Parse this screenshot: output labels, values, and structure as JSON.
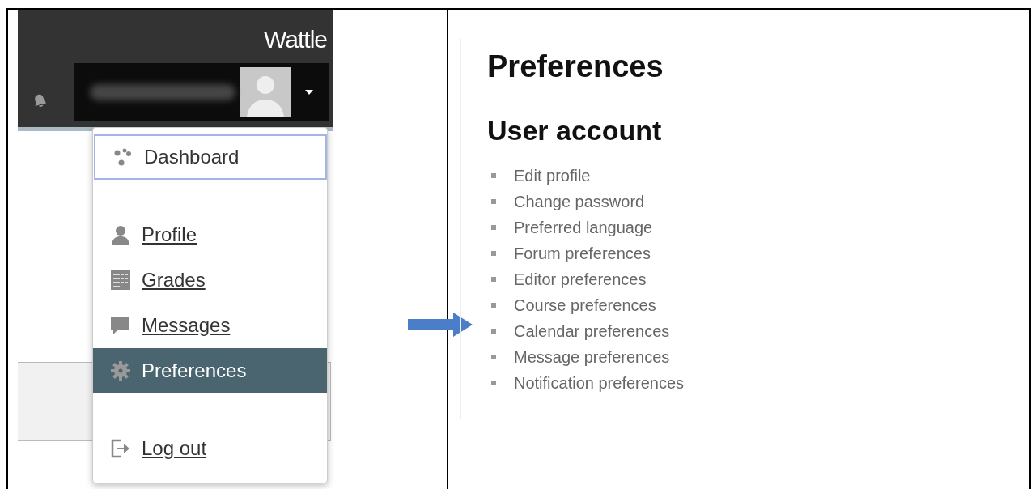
{
  "site_header": {
    "brand": "Wattle"
  },
  "user_menu": {
    "items": [
      {
        "label": "Dashboard",
        "selected": false,
        "focused": true,
        "underlined": false
      },
      {
        "label": "Profile",
        "selected": false,
        "focused": false,
        "underlined": true
      },
      {
        "label": "Grades",
        "selected": false,
        "focused": false,
        "underlined": true
      },
      {
        "label": "Messages",
        "selected": false,
        "focused": false,
        "underlined": true
      },
      {
        "label": "Preferences",
        "selected": true,
        "focused": false,
        "underlined": false
      },
      {
        "label": "Log out",
        "selected": false,
        "focused": false,
        "underlined": true
      }
    ]
  },
  "preferences_page": {
    "title": "Preferences",
    "section_title": "User account",
    "links": [
      "Edit profile",
      "Change password",
      "Preferred language",
      "Forum preferences",
      "Editor preferences",
      "Course preferences",
      "Calendar preferences",
      "Message preferences",
      "Notification preferences"
    ]
  }
}
